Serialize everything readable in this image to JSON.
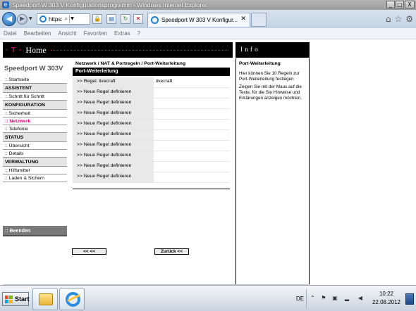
{
  "window": {
    "title": "Speedport W 303 V Konfigurationsprogramm - Windows Internet Explorer",
    "controls": {
      "minimize": "_",
      "maximize": "□",
      "close": "X"
    }
  },
  "browser": {
    "address": "https:",
    "tab_label": "Speedport W 303 V Konfigur...",
    "tab_close": "✕",
    "menu": [
      "Datei",
      "Bearbeiten",
      "Ansicht",
      "Favoriten",
      "Extras",
      "?"
    ]
  },
  "header": {
    "logo": "· T ·",
    "home": "Home",
    "info": "Info"
  },
  "sidebar": {
    "device": "Speedport W 303V",
    "items": [
      {
        "label": ":: Startseite",
        "kind": "link"
      },
      {
        "label": "ASSISTENT",
        "kind": "section"
      },
      {
        "label": ":: Schritt für Schritt",
        "kind": "link"
      },
      {
        "label": "KONFIGURATION",
        "kind": "section"
      },
      {
        "label": ":: Sicherheit",
        "kind": "link"
      },
      {
        "label": ":: Netzwerk",
        "kind": "active"
      },
      {
        "label": ":: Telefonie",
        "kind": "link"
      },
      {
        "label": "STATUS",
        "kind": "section"
      },
      {
        "label": ":: Übersicht",
        "kind": "link"
      },
      {
        "label": ":: Details",
        "kind": "link"
      },
      {
        "label": "VERWALTUNG",
        "kind": "section"
      },
      {
        "label": ":: Hilfsmittel",
        "kind": "link"
      },
      {
        "label": ":: Laden & Sichern",
        "kind": "link"
      }
    ],
    "end": ":: Beenden"
  },
  "main": {
    "breadcrumb": "Netzwerk / NAT & Portregeln / Port-Weiterleitung",
    "section_title": "Port-Weiterleitung",
    "rules": [
      {
        "label": ">> Regel: livecraft",
        "value": "livecraft"
      },
      {
        "label": ">> Neue Regel definieren",
        "value": ""
      },
      {
        "label": ">> Neue Regel definieren",
        "value": ""
      },
      {
        "label": ">> Neue Regel definieren",
        "value": ""
      },
      {
        "label": ">> Neue Regel definieren",
        "value": ""
      },
      {
        "label": ">> Neue Regel definieren",
        "value": ""
      },
      {
        "label": ">> Neue Regel definieren",
        "value": ""
      },
      {
        "label": ">> Neue Regel definieren",
        "value": ""
      },
      {
        "label": ">> Neue Regel definieren",
        "value": ""
      },
      {
        "label": ">> Neue Regel definieren",
        "value": ""
      }
    ],
    "btn_back": "<< <<",
    "btn_zurueck": "Zurück <<"
  },
  "info_panel": {
    "title": "Port-Weiterleitung",
    "text1": "Hier können Sie 10 Regeln zur Port-Weiterleitung festlegen",
    "text2": "Zeigen Sie mit der Maus auf die Texte, für die Sie Hinweise und Erklärungen anzeigen möchten."
  },
  "taskbar": {
    "start": "Start",
    "lang": "DE",
    "time": "10:22",
    "date": "22.08.2012"
  },
  "colors": {
    "magenta": "#e20074",
    "black": "#000000"
  }
}
